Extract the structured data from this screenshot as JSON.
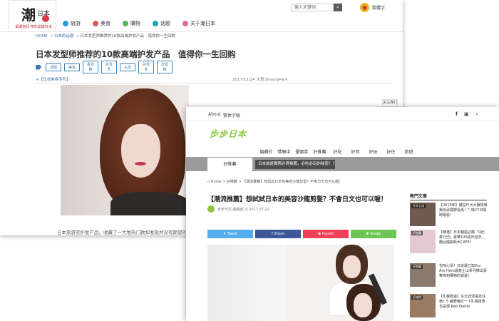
{
  "window1": {
    "logo": {
      "big": "潮",
      "small": "日本",
      "tagline": "最潮資訊 帶你認識日本"
    },
    "nav": [
      {
        "label": "旅游",
        "color": "#2a9fd6"
      },
      {
        "label": "美食",
        "color": "#e05a5a"
      },
      {
        "label": "購物",
        "color": "#5ab45a"
      },
      {
        "label": "话题",
        "color": "#1aa7b8"
      },
      {
        "label": "关于潮日本",
        "color": "#e26aa2"
      }
    ],
    "search": {
      "placeholder": "输入关键词",
      "button_icon": "search-icon"
    },
    "weibo_icon": "weibo-icon",
    "lang": "繁體字",
    "breadcrumb": [
      "HOME",
      "日本的话题",
      "日本发型师推荐的10款高端护发产品　值得你一生回购"
    ],
    "title": "日本发型师推荐的10款高端护发产品　值得你一生回购",
    "tags": [
      "话题",
      "美容",
      "香发精",
      "护发乳",
      "头发",
      "护发素",
      "洗发精"
    ],
    "category": "+【日本美容专栏】",
    "date": "2017/11/24",
    "author": "文责:BeautyPark",
    "body_text": "日本旅游买护发产品。收藏了一大堆热门款却发现并没有期望的好用。日本",
    "zoom_button": "关注我们"
  },
  "window2": {
    "top_links": [
      "About",
      "繁体字版"
    ],
    "social_icons": [
      "facebook-icon",
      "instagram-icon",
      "search-icon"
    ],
    "logo": "步步日本",
    "nav": [
      "編輯社",
      "情報中",
      "優惠券",
      "好推薦",
      "好吃",
      "好買",
      "好玩",
      "好住",
      "旅遊"
    ],
    "tab": "好推薦",
    "ticker": "日本旅遊實際必買推薦，必吃必玩的秘密！！！",
    "breadcrumb": "Home > 好推薦 > 【潮流推薦】想試試日本的美容沙龍剪髮？不會日文也可以喔！",
    "title": "【潮流推薦】想試試日本的美容沙龍剪髮？不會日文也可以喔！",
    "author": "步步日本 編輯部",
    "date": "2017.07.22",
    "share": [
      {
        "label": "Tweet",
        "color": "#55acee"
      },
      {
        "label": "Share",
        "color": "#3b5998"
      },
      {
        "label": "Pocket",
        "color": "#ef4056"
      },
      {
        "label": "feedly",
        "color": "#6cc655"
      }
    ],
    "sidebar_title": "熱門文章",
    "sidebar": [
      {
        "badge": "步步之旅",
        "text": "【2019年】購在F!大大賽馬場東京武蔵野看馬！？時27日間時期看！",
        "color": "#6f5a4f"
      },
      {
        "badge": "好推薦",
        "text": "【精選】日本種點必購「Q比果乃巴」豪華100週年紀念，購台團開新出CAFE！",
        "color": "#e4c9d3"
      },
      {
        "badge": "好推薦",
        "text": "包味心情！日本最已知You Are Here最富士山系列推出豪華夜到購物的週邊！",
        "color": "#8a7a6e"
      },
      {
        "badge": "好旅遊",
        "text": "【札幌旅遊】在北近郊溫泉住宿！5 鹿野壕近一下札幌夜景也是很 Red Planet",
        "color": "#9a7b63"
      }
    ]
  }
}
